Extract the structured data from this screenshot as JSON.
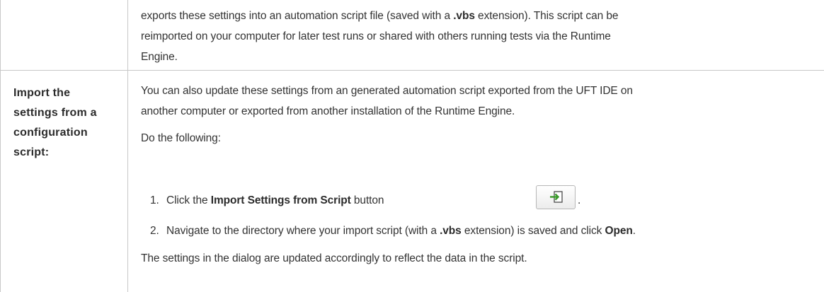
{
  "top_row": {
    "lines": [
      {
        "pre": "exports these settings into an automation script file (saved with a ",
        "bold": ".vbs",
        "post": " extension). This script can be"
      },
      {
        "text": "reimported on your computer for later test runs or shared with others running tests via the Runtime"
      },
      {
        "text": "Engine."
      }
    ]
  },
  "import_row": {
    "label_lines": [
      "Import the",
      "settings from a",
      "configuration",
      "script:"
    ],
    "intro_lines": [
      "You can also update these settings from an generated automation script exported from the UFT IDE on",
      "another computer or exported from another installation of the Runtime Engine."
    ],
    "do_following": "Do the following:",
    "steps": [
      {
        "num": "1.",
        "pre": "Click the ",
        "bold": "Import Settings from Script",
        "post": " button",
        "after_icon": ".",
        "icon": "import-icon"
      },
      {
        "num": "2.",
        "pre": "Navigate to the directory where your import script (with a ",
        "bold": ".vbs",
        "mid": " extension) is saved and click ",
        "bold2": "Open",
        "post": "."
      }
    ],
    "result": "The settings in the dialog are updated accordingly to reflect the data in the script."
  }
}
